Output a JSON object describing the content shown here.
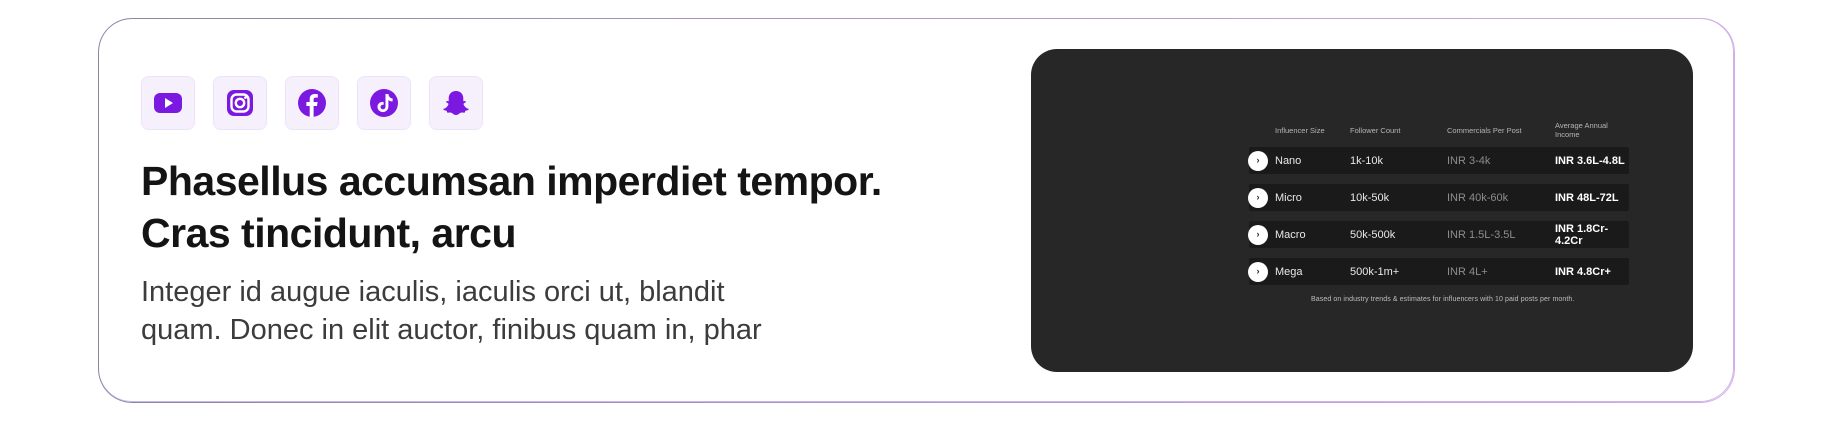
{
  "social_icons": [
    "youtube-icon",
    "instagram-icon",
    "facebook-icon",
    "tiktok-icon",
    "snapchat-icon"
  ],
  "colors": {
    "accent": "#7b19e0",
    "panel": "#272727",
    "row": "#1a1a1a"
  },
  "headline": {
    "line1": "Phasellus accumsan imperdiet tempor.",
    "line2": "Cras tincidunt, arcu"
  },
  "subtext": {
    "line1": "Integer id augue iaculis, iaculis orci ut, blandit",
    "line2": "quam. Donec in elit auctor, finibus quam in, phar"
  },
  "table": {
    "headers": [
      "Influencer Size",
      "Follower Count",
      "Commercials Per Post",
      "Average Annual Income"
    ],
    "rows": [
      {
        "size": "Nano",
        "followers": "1k-10k",
        "commercials": "INR 3-4k",
        "income": "INR 3.6L-4.8L"
      },
      {
        "size": "Micro",
        "followers": "10k-50k",
        "commercials": "INR 40k-60k",
        "income": "INR 48L-72L"
      },
      {
        "size": "Macro",
        "followers": "50k-500k",
        "commercials": "INR 1.5L-3.5L",
        "income": "INR 1.8Cr-4.2Cr"
      },
      {
        "size": "Mega",
        "followers": "500k-1m+",
        "commercials": "INR 4L+",
        "income": "INR 4.8Cr+"
      }
    ],
    "row_icon": "chevron-right-icon",
    "footnote": "Based on industry trends & estimates for influencers with 10 paid posts per month."
  }
}
